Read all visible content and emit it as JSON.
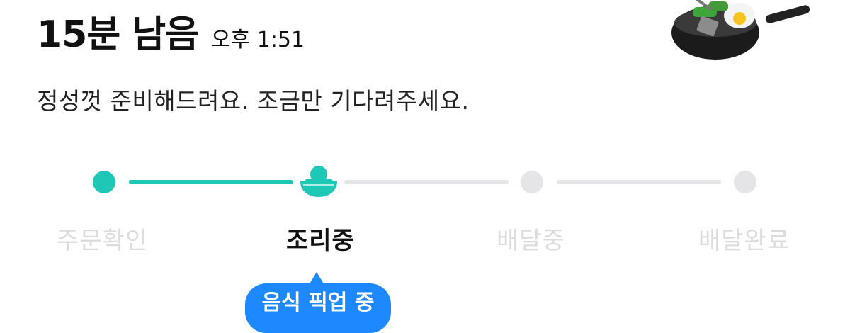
{
  "header": {
    "eta": "15분 남음",
    "time": "오후 1:51",
    "subtitle": "정성껏 준비해드려요. 조금만 기다려주세요."
  },
  "progress": {
    "current_step": 2,
    "steps": [
      {
        "label": "주문확인",
        "status": "done"
      },
      {
        "label": "조리중",
        "status": "current"
      },
      {
        "label": "배달중",
        "status": "todo"
      },
      {
        "label": "배달완료",
        "status": "todo"
      }
    ]
  },
  "tooltip": {
    "text": "음식 픽업 중"
  },
  "colors": {
    "accent": "#1fc7b6",
    "inactive": "#e5e5e8",
    "tooltip": "#1e88ff"
  },
  "icons": {
    "hero": "frying-pan-icon",
    "current_step": "rice-bowl-icon"
  }
}
